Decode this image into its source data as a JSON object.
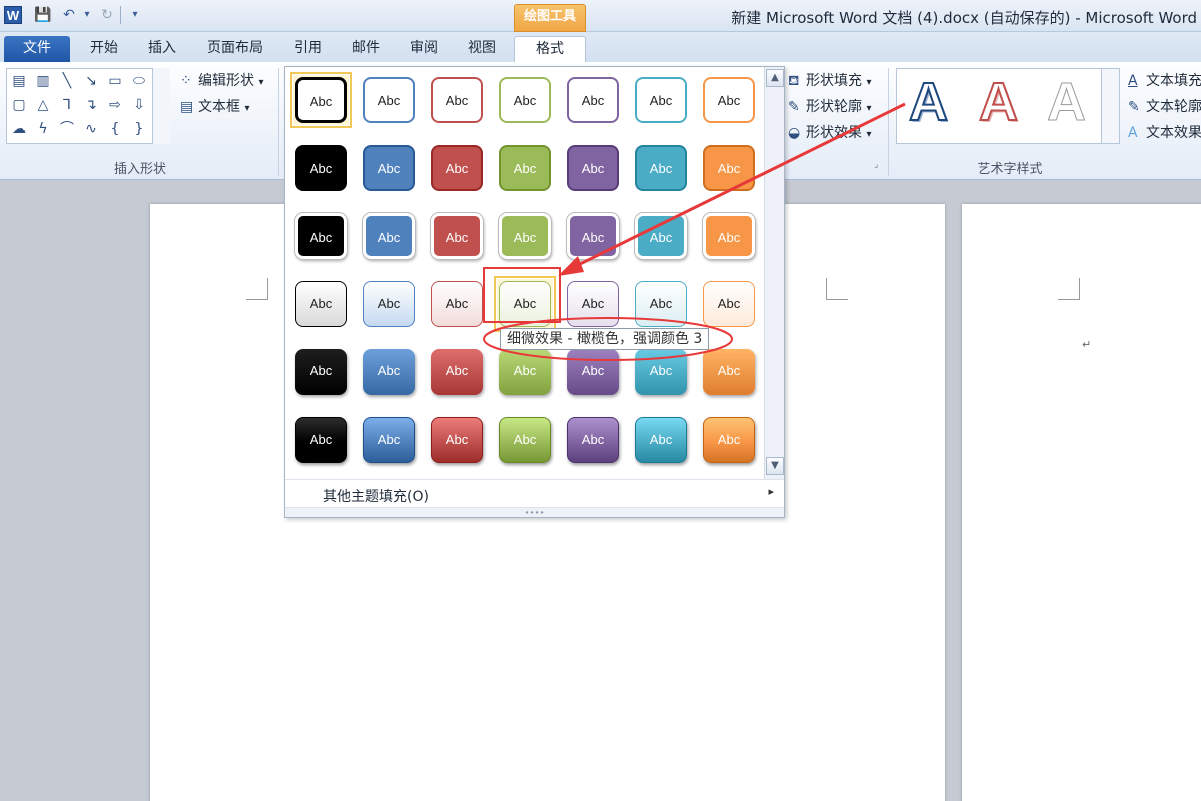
{
  "window": {
    "title": "新建 Microsoft Word 文档 (4).docx (自动保存的)  -  Microsoft Word",
    "app_icon_letter": "W",
    "context_tab_header": "绘图工具"
  },
  "quick_access": [
    {
      "icon": "save-icon",
      "glyph": "💾"
    },
    {
      "icon": "undo-icon",
      "glyph": "↶"
    },
    {
      "icon": "dropdown-arrow-icon",
      "glyph": "▾"
    },
    {
      "icon": "redo-icon",
      "glyph": "↻"
    },
    {
      "icon": "customize-qat-icon",
      "glyph": "▾"
    }
  ],
  "tabs": [
    {
      "label": "文件"
    },
    {
      "label": "开始"
    },
    {
      "label": "插入"
    },
    {
      "label": "页面布局"
    },
    {
      "label": "引用"
    },
    {
      "label": "邮件"
    },
    {
      "label": "审阅"
    },
    {
      "label": "视图"
    },
    {
      "label": "格式"
    }
  ],
  "ribbon": {
    "insert_shapes": {
      "group_label": "插入形状",
      "edit_shape": "编辑形状",
      "text_box": "文本框",
      "dropdown_glyph": "▾"
    },
    "shape_styles": {
      "fill": "形状填充",
      "outline": "形状轮廓",
      "effects": "形状效果"
    },
    "wordart": {
      "group_label": "艺术字样式",
      "letter": "A",
      "text_fill": "文本填充",
      "text_outline": "文本轮廓",
      "text_effects": "文本效果"
    }
  },
  "gallery": {
    "swatch_label": "Abc",
    "tooltip": "细微效果 - 橄榄色，强调颜色 3",
    "more_fills": "其他主题填充(O)",
    "scroll_up": "▲",
    "scroll_down": "▼",
    "footer_arrow": "▸",
    "grip": "∙∙∙∙",
    "accent_colors": [
      "#000000",
      "#4f81bd",
      "#c0504d",
      "#9bbb59",
      "#8064a2",
      "#4bacc6",
      "#f79646"
    ],
    "light_fills": [
      "#d9d9d9",
      "#c6d9f1",
      "#f2dcdb",
      "#ebf1de",
      "#e5e0ec",
      "#dbeef4",
      "#fdeada"
    ],
    "row_styles": [
      "colored-outline",
      "colored-fill",
      "light-1-outline",
      "subtle-effect",
      "moderate-effect",
      "intense-effect"
    ],
    "hovered": "subtle-effect-olive-accent-3"
  },
  "document": {
    "paragraph_mark": "↵"
  },
  "annotations": {
    "highlight_color": "#e8393a"
  }
}
